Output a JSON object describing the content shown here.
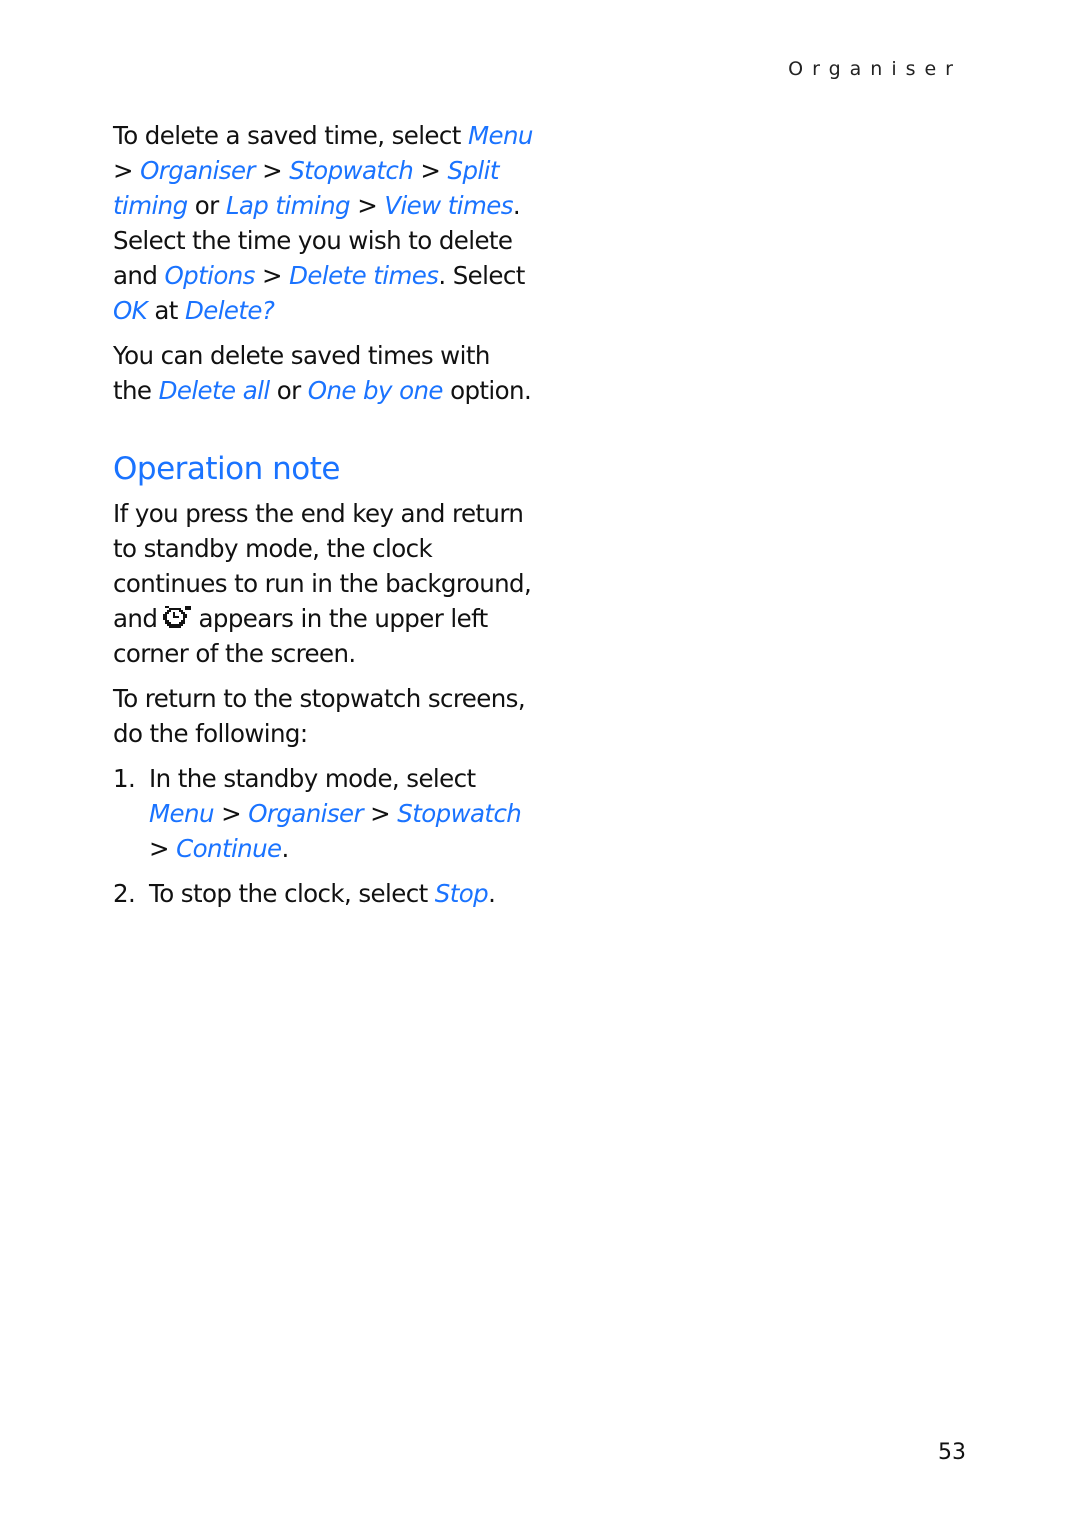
{
  "header": {
    "section": "Organiser"
  },
  "para1": {
    "t1": "To delete a saved time, select ",
    "menu": "Menu",
    "sep": " > ",
    "organiser": "Organiser",
    "stopwatch": "Stopwatch",
    "split": "Split timing",
    "or": " or ",
    "lap": "Lap timing",
    "view": "View times",
    "t2": ". Select the time you wish to delete and ",
    "options": "Options",
    "delete_times": "Delete times",
    "t3": ". Select ",
    "ok": "OK",
    "at": " at ",
    "delete_q": "Delete?"
  },
  "para2": {
    "t1": "You can delete saved times with the ",
    "delete_all": "Delete all",
    "or": " or ",
    "one_by_one": "One by one",
    "t2": " option."
  },
  "section": {
    "title": "Operation note"
  },
  "para3": {
    "t1": "If you press the end key and return to standby mode, the clock continues to run in the background, and",
    "icon": "stopwatch-clock-icon",
    "t2": " appears in the upper left corner of the screen."
  },
  "para4": {
    "text": "To return to the stopwatch screens, do the following:"
  },
  "steps": [
    {
      "num": "1.",
      "t1": "In the standby mode, select ",
      "menu": "Menu",
      "organiser": "Organiser",
      "stopwatch": "Stopwatch",
      "continue": "Continue",
      "end": "."
    },
    {
      "num": "2.",
      "t1": "To stop the clock, select ",
      "stop": "Stop",
      "end": "."
    }
  ],
  "footer": {
    "page_number": "53"
  },
  "colors": {
    "highlight": "#1a73ff",
    "text": "#111111"
  }
}
